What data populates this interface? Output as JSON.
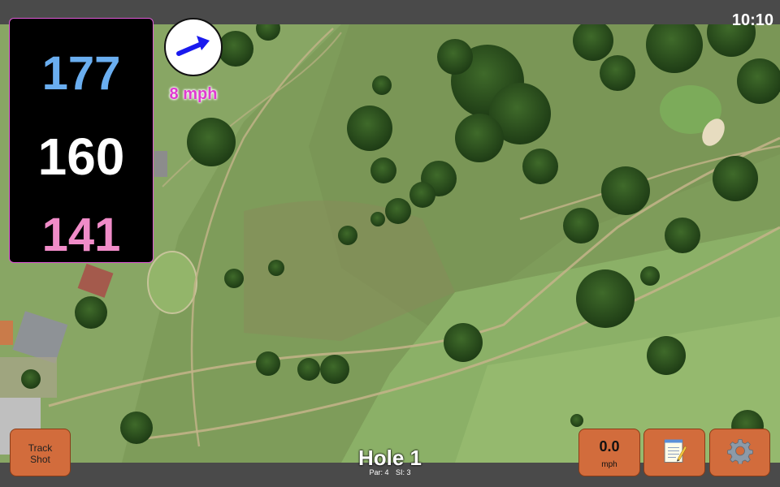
{
  "status": {
    "time": "10:10"
  },
  "distances": {
    "back": "177",
    "middle": "160",
    "front": "141",
    "back_color": "#6aaef0",
    "middle_color": "#ffffff",
    "front_color": "#f08cc8"
  },
  "wind": {
    "speed_label": "8 mph",
    "direction_icon": "arrow-icon",
    "arrow_color": "#1a1aee",
    "label_color": "#e03ad0"
  },
  "hole": {
    "title": "Hole 1",
    "par_label": "Par: 4",
    "si_label": "SI: 3"
  },
  "buttons": {
    "track_shot_line1": "Track",
    "track_shot_line2": "Shot",
    "wind_value": "0.0",
    "wind_unit": "mph",
    "notes_icon": "notepad-icon",
    "settings_icon": "gear-icon",
    "button_color": "#d26c3c"
  },
  "map": {
    "type": "satellite-golf-course"
  }
}
